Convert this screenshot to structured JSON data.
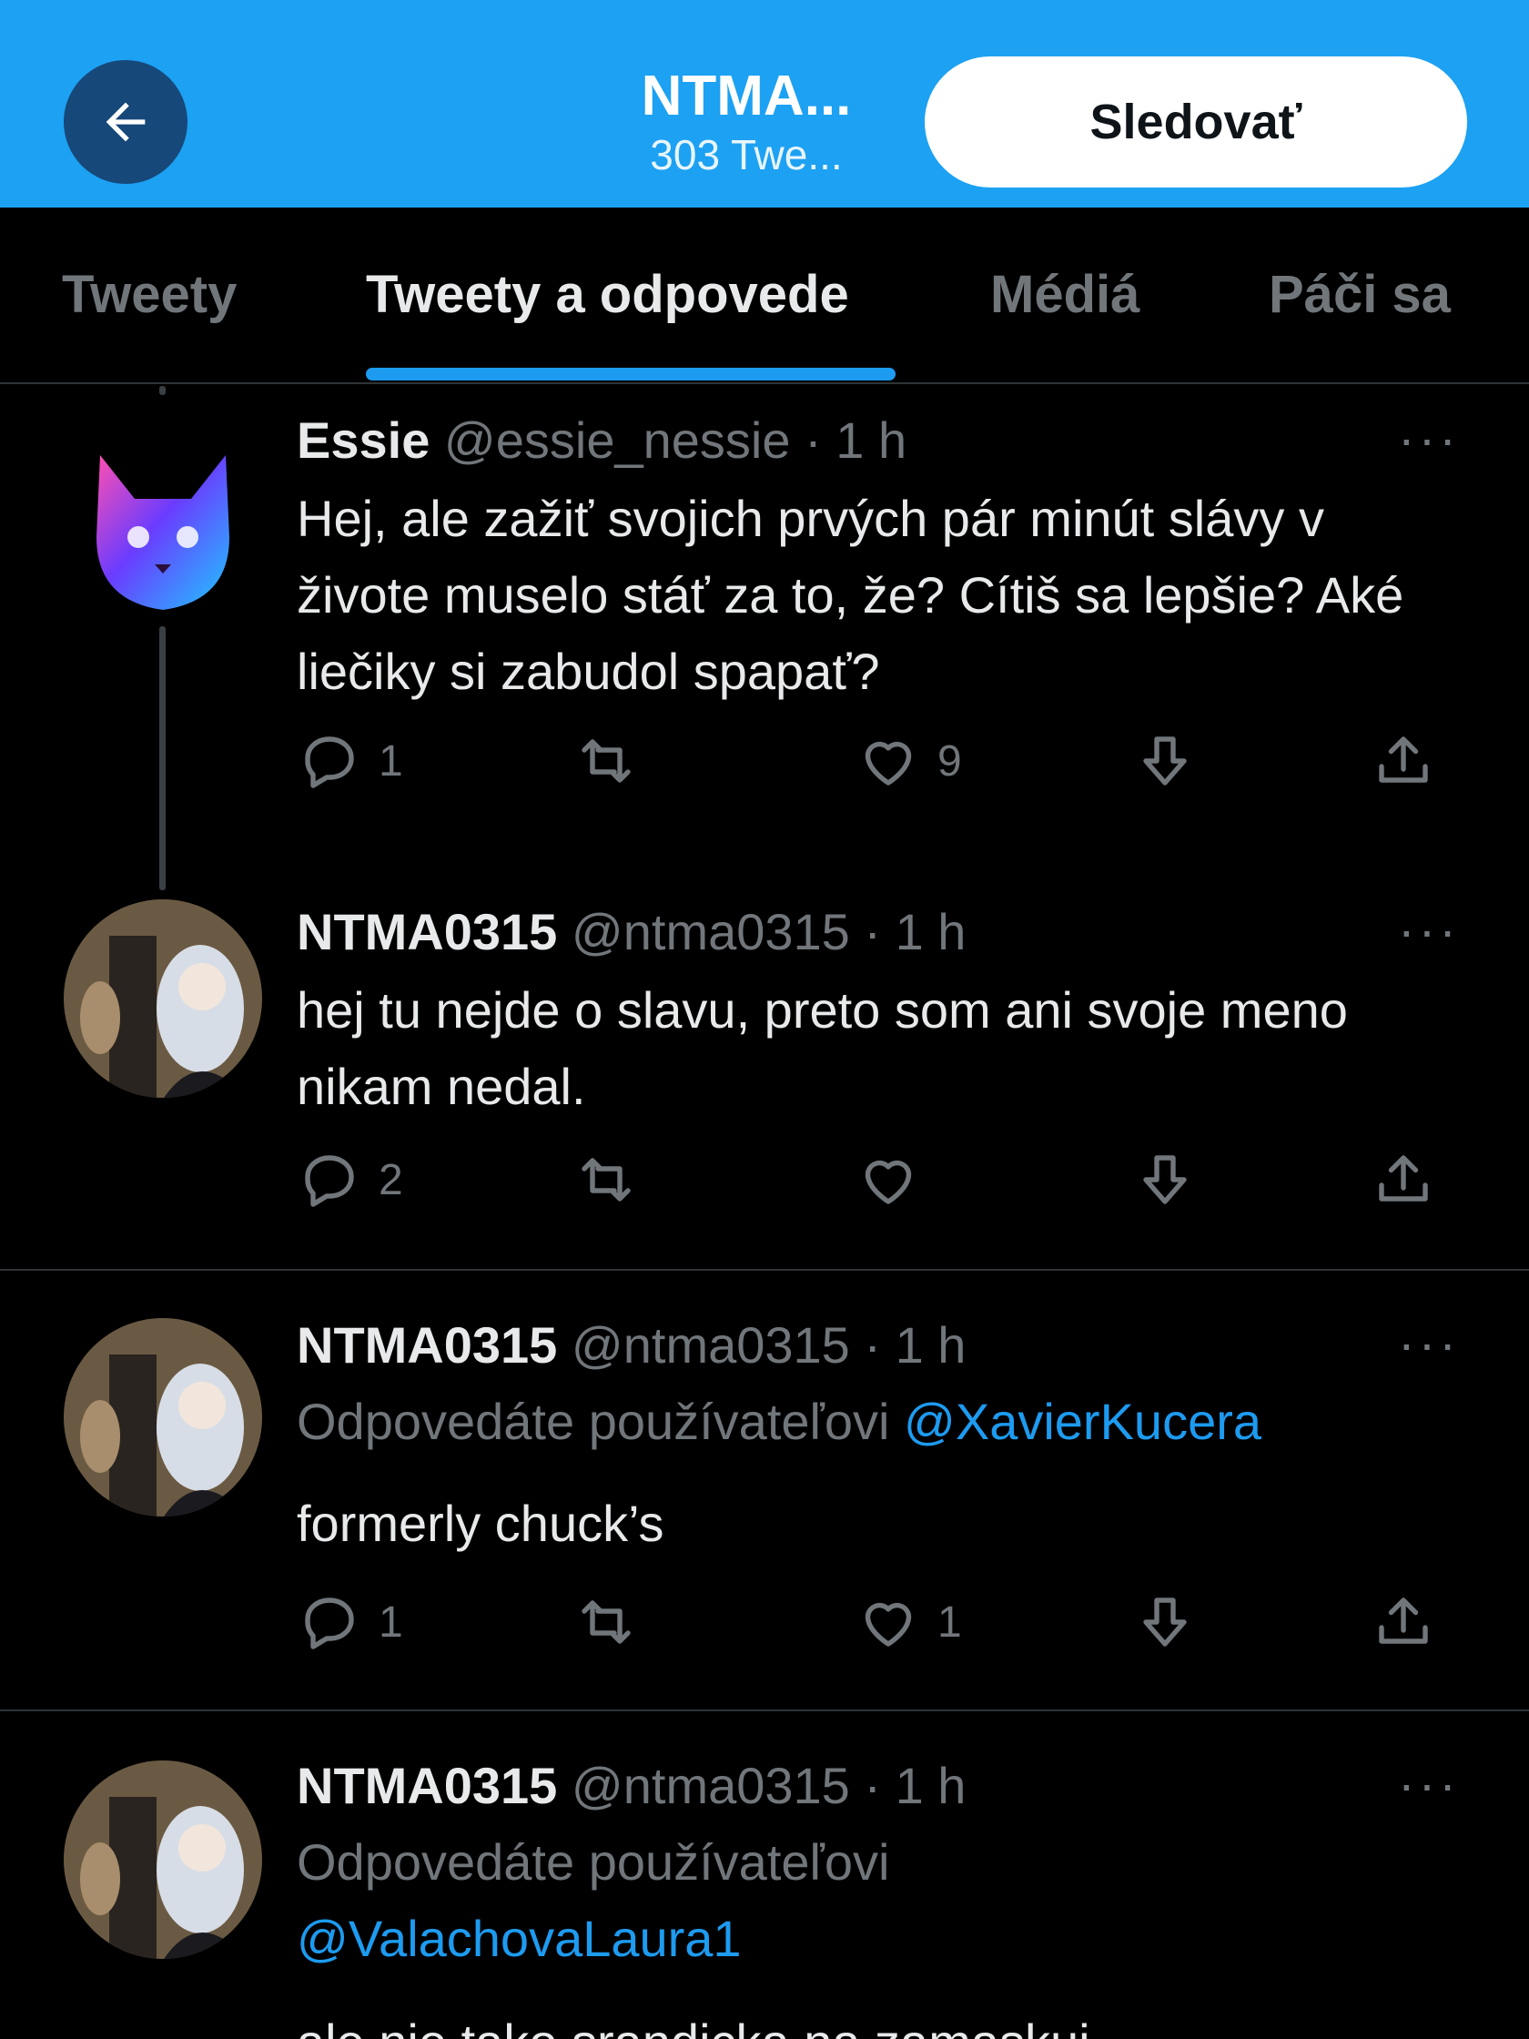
{
  "header": {
    "title": "NTMA...",
    "subtitle": "303 Twe...",
    "follow_label": "Sledovať",
    "accent_color": "#1da1f2",
    "back_icon": "arrow-left-icon"
  },
  "tabs": [
    {
      "label": "Tweety",
      "active": false
    },
    {
      "label": "Tweety a odpovede",
      "active": true
    },
    {
      "label": "Médiá",
      "active": false
    },
    {
      "label": "Páči sa",
      "active": false
    }
  ],
  "tweets": [
    {
      "name": "Essie",
      "handle": "@essie_nessie",
      "time": "1 h",
      "text": "Hej, ale zažiť svojich prvých pár minút slávy v živote muselo stáť za to, že? Cítiš sa lepšie? Aké liečiky si zabudol spapať?",
      "replies": "1",
      "retweets": "",
      "likes": "9"
    },
    {
      "name": "NTMA0315",
      "handle": "@ntma0315",
      "time": "1 h",
      "text": "hej tu nejde o slavu, preto som ani svoje meno nikam nedal.",
      "replies": "2",
      "retweets": "",
      "likes": ""
    },
    {
      "name": "NTMA0315",
      "handle": "@ntma0315",
      "time": "1 h",
      "reply_to_prefix": "Odpovedáte používateľovi",
      "reply_to_mention": "@XavierKucera",
      "text": "formerly chuck’s",
      "replies": "1",
      "retweets": "",
      "likes": "1"
    },
    {
      "name": "NTMA0315",
      "handle": "@ntma0315",
      "time": "1 h",
      "reply_to_prefix": "Odpovedáte používateľovi",
      "reply_to_mention": "@ValachovaLaura1",
      "text": "ale nie tako srandicka na zamaskui"
    }
  ],
  "separator": "·",
  "more_label": "···"
}
